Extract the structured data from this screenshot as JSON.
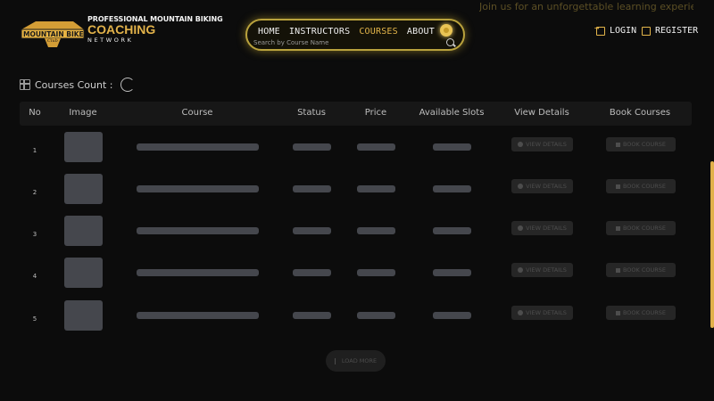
{
  "header": {
    "tagline": "Join us for an unforgettable learning experience!",
    "logo": {
      "badge_text": "MOUNTAIN BIKE",
      "badge_sub": "Club",
      "line1": "PROFESSIONAL MOUNTAIN BIKING",
      "line2": "COACHING",
      "line3": "NETWORK"
    },
    "nav": {
      "items": [
        "HOME",
        "INSTRUCTORS",
        "COURSES",
        "ABOUT US"
      ],
      "active": "COURSES",
      "search_placeholder": "Search by Course Name"
    },
    "auth": {
      "login": "LOGIN",
      "register": "REGISTER"
    }
  },
  "courses": {
    "count_label": "Courses Count :",
    "columns": [
      "No",
      "Image",
      "Course",
      "Status",
      "Price",
      "Available Slots",
      "View Details",
      "Book Courses"
    ],
    "rows": [
      {
        "no": "1",
        "view_label": "VIEW DETAILS",
        "book_label": "BOOK COURSE"
      },
      {
        "no": "2",
        "view_label": "VIEW DETAILS",
        "book_label": "BOOK COURSE"
      },
      {
        "no": "3",
        "view_label": "VIEW DETAILS",
        "book_label": "BOOK COURSE"
      },
      {
        "no": "4",
        "view_label": "VIEW DETAILS",
        "book_label": "BOOK COURSE"
      },
      {
        "no": "5",
        "view_label": "VIEW DETAILS",
        "book_label": "BOOK COURSE"
      }
    ],
    "load_more": "LOAD MORE"
  },
  "colors": {
    "accent": "#e3b54a",
    "background": "#0c0c0c",
    "skeleton": "#45474d"
  }
}
